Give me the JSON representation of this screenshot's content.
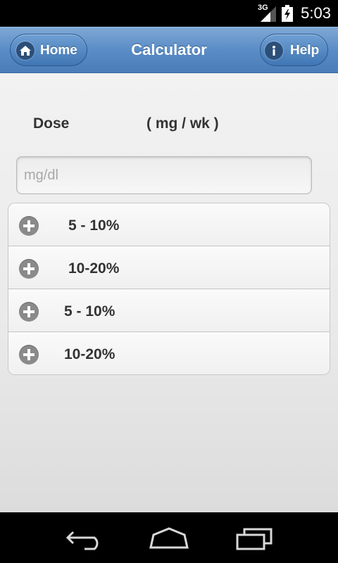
{
  "status_bar": {
    "network": "3G",
    "time": "5:03"
  },
  "header": {
    "title": "Calculator",
    "home_label": "Home",
    "help_label": "Help"
  },
  "form": {
    "dose_label": "Dose",
    "unit_label": "( mg / wk )",
    "input_placeholder": "mg/dl",
    "input_value": ""
  },
  "list": {
    "items": [
      {
        "label": "5 - 10%",
        "icon": "plus-icon"
      },
      {
        "label": "10-20%",
        "icon": "plus-icon"
      },
      {
        "label": "5 - 10%",
        "icon": "plus-icon"
      },
      {
        "label": "10-20%",
        "icon": "plus-icon"
      }
    ]
  },
  "nav_bar": {
    "buttons": [
      "back-icon",
      "home-icon",
      "recents-icon"
    ]
  },
  "colors": {
    "header_blue": "#5a8cc6",
    "button_blue": "#3f76b4",
    "background": "#efefef"
  }
}
